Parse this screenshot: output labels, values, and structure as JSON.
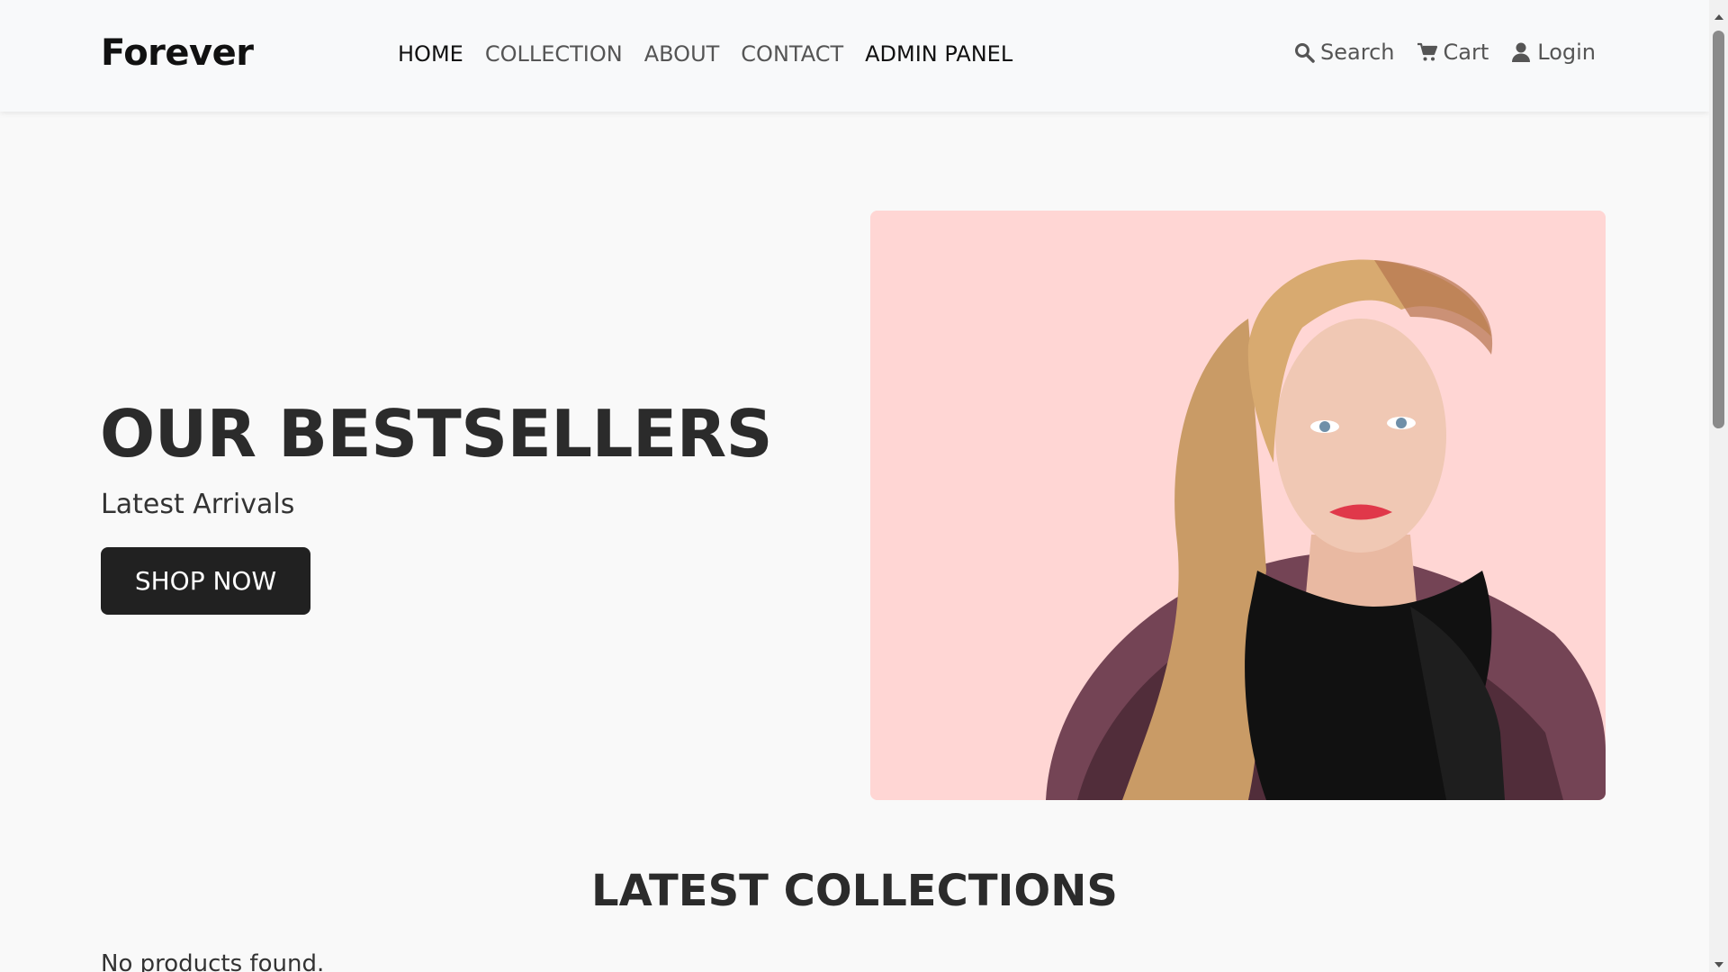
{
  "brand": {
    "name": "Forever"
  },
  "nav": {
    "links": [
      {
        "label": "HOME",
        "active": true
      },
      {
        "label": "COLLECTION",
        "active": false
      },
      {
        "label": "ABOUT",
        "active": false
      },
      {
        "label": "CONTACT",
        "active": false
      },
      {
        "label": "ADMIN PANEL",
        "active": false
      }
    ],
    "actions": [
      {
        "label": "Search",
        "icon": "search-icon"
      },
      {
        "label": "Cart",
        "icon": "cart-icon"
      },
      {
        "label": "Login",
        "icon": "user-icon"
      }
    ]
  },
  "hero": {
    "title": "OUR BESTSELLERS",
    "subtitle": "Latest Arrivals",
    "button_label": "SHOP NOW",
    "image_bg": "#ffd6d4"
  },
  "collections": {
    "title": "LATEST COLLECTIONS",
    "empty_message": "No products found."
  },
  "colors": {
    "primary_button": "#212121",
    "header_bg": "#f8f9fa",
    "page_bg": "#f9f9f9"
  }
}
